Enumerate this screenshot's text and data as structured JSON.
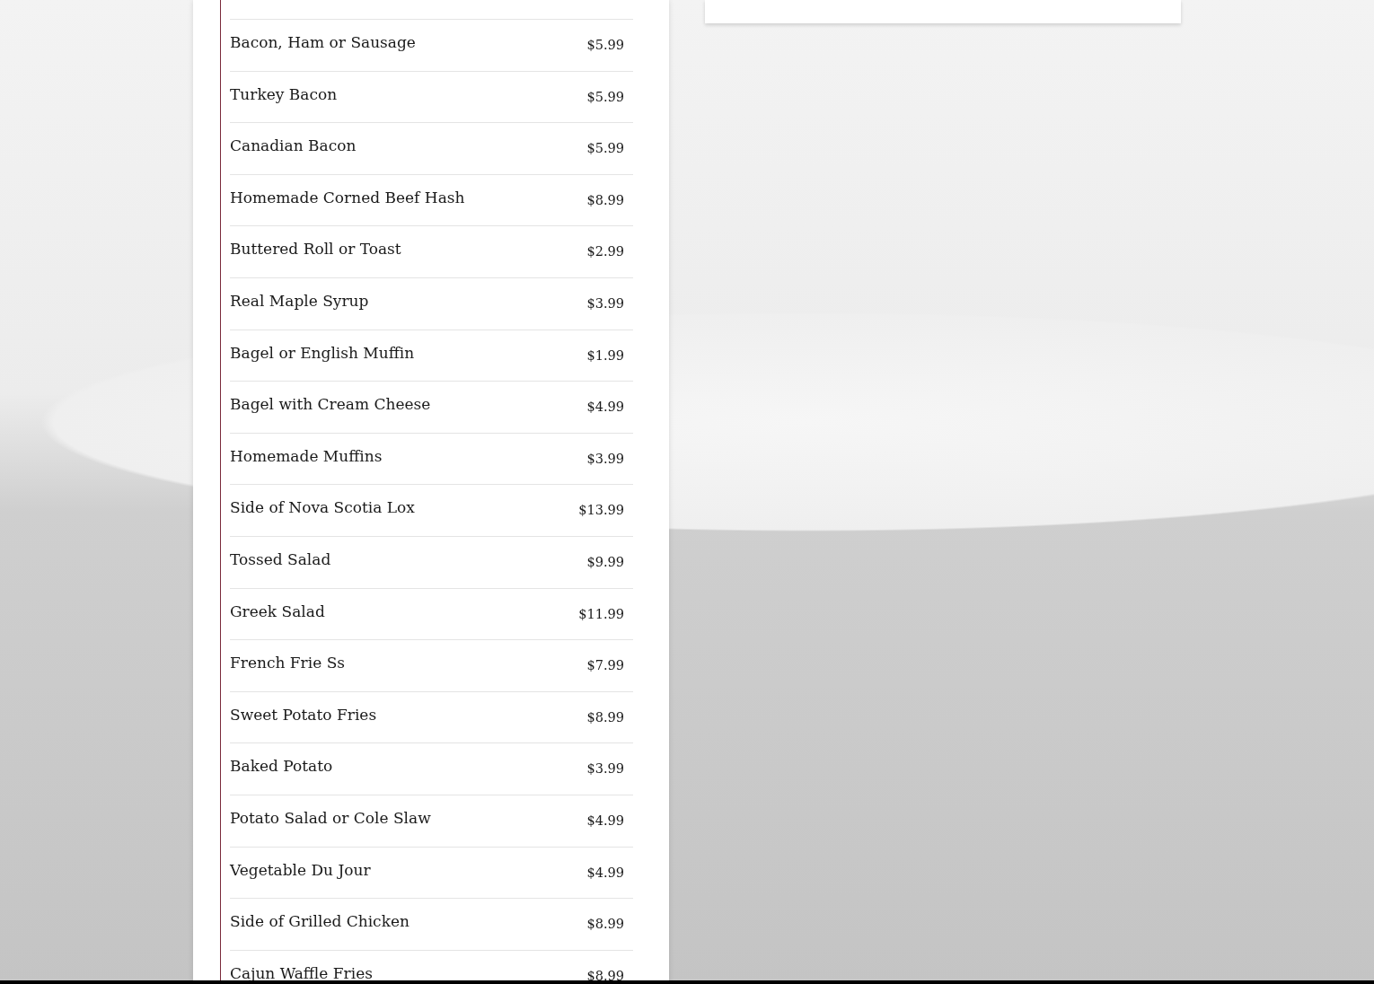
{
  "menu_items": [
    {
      "name": "Bacon, Ham or Sausage",
      "price": "$5.99"
    },
    {
      "name": "Turkey Bacon",
      "price": "$5.99"
    },
    {
      "name": "Canadian Bacon",
      "price": "$5.99"
    },
    {
      "name": "Homemade Corned Beef Hash",
      "price": "$8.99"
    },
    {
      "name": "Buttered Roll or Toast",
      "price": "$2.99"
    },
    {
      "name": "Real Maple Syrup",
      "price": "$3.99"
    },
    {
      "name": "Bagel or English Muffin",
      "price": "$1.99"
    },
    {
      "name": "Bagel with Cream Cheese",
      "price": "$4.99"
    },
    {
      "name": "Homemade Muffins",
      "price": "$3.99"
    },
    {
      "name": "Side of Nova Scotia Lox",
      "price": "$13.99"
    },
    {
      "name": "Tossed Salad",
      "price": "$9.99"
    },
    {
      "name": "Greek Salad",
      "price": "$11.99"
    },
    {
      "name": "French Frie Ss",
      "price": "$7.99"
    },
    {
      "name": "Sweet Potato Fries",
      "price": "$8.99"
    },
    {
      "name": "Baked Potato",
      "price": "$3.99"
    },
    {
      "name": "Potato Salad or Cole Slaw",
      "price": "$4.99"
    },
    {
      "name": "Vegetable Du Jour",
      "price": "$4.99"
    },
    {
      "name": "Side of Grilled Chicken",
      "price": "$8.99"
    },
    {
      "name": "Cajun Waffle Fries",
      "price": "$8.99"
    }
  ]
}
